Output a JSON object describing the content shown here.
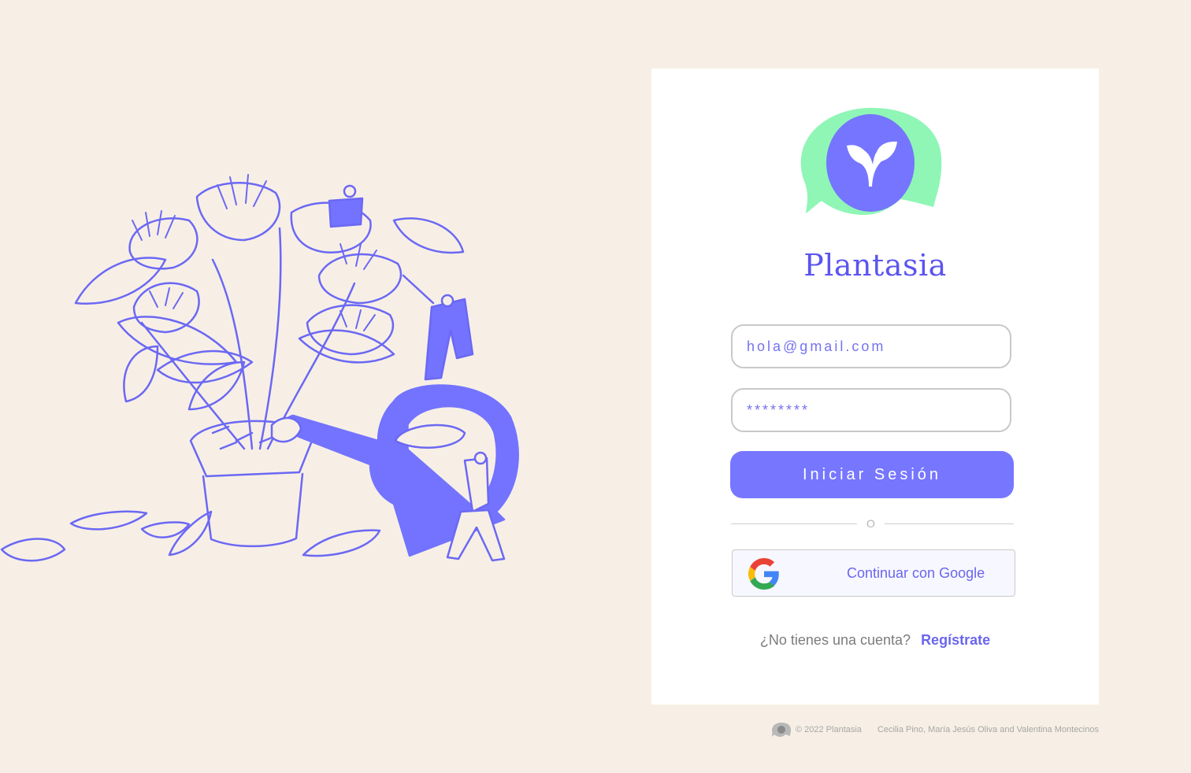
{
  "brand": {
    "name": "Plantasia",
    "colors": {
      "primary": "#7676ff",
      "accent": "#8ef5b8",
      "background": "#f7efe5"
    }
  },
  "illustration": {
    "icon": "plant-watering-illustration"
  },
  "login": {
    "email_placeholder": "hola@gmail.com",
    "password_placeholder": "********",
    "submit_label": "Iniciar Sesión",
    "divider_text": "O",
    "google_label": "Continuar con Google",
    "signup_question": "¿No tienes una cuenta?",
    "signup_link": "Regístrate"
  },
  "footer": {
    "copyright": "© 2022 Plantasia",
    "credits": "Cecilia Pino, María Jesús Oliva and Valentina Montecinos"
  }
}
